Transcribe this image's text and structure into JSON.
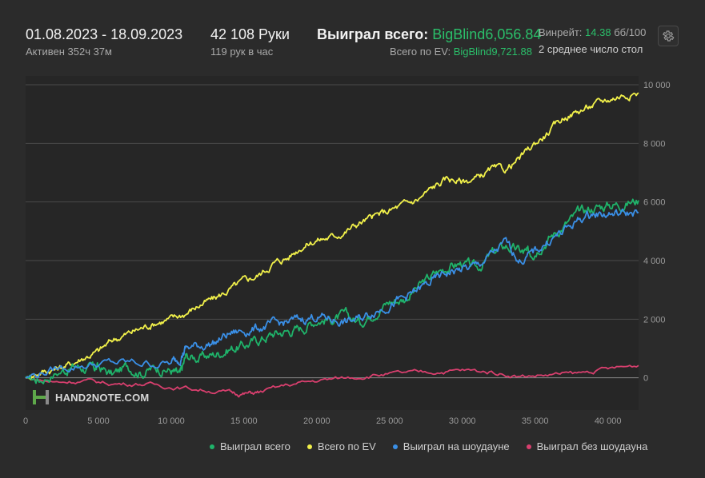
{
  "header": {
    "date_range": "01.08.2023 - 18.09.2023",
    "active_time": "Активен 352ч 37м",
    "hands": "42 108 Руки",
    "hands_per_hour": "119 рук в час",
    "won_label": "Выиграл всего:",
    "won_value": "BigBlind6,056.84",
    "ev_label": "Всего по EV:",
    "ev_value": "BigBlind9,721.88",
    "winrate_label": "Винрейт:",
    "winrate_value": "14.38",
    "winrate_unit": "бб/100",
    "avg_label": "2 среднее число стол"
  },
  "colors": {
    "green": "#1fb36a",
    "yellow": "#f1f04a",
    "blue": "#3a8fe6",
    "pink": "#d83f6e",
    "grid": "#4a4a4a",
    "axis_text": "#9a9a9a"
  },
  "logo": {
    "text": "HAND2NOTE.COM"
  },
  "chart_data": {
    "type": "line",
    "x_ticks": [
      0,
      5000,
      10000,
      15000,
      20000,
      25000,
      30000,
      35000,
      40000
    ],
    "x_tick_labels": [
      "0",
      "5 000",
      "10 000",
      "15 000",
      "20 000",
      "25 000",
      "30 000",
      "35 000",
      "40 000"
    ],
    "y_ticks": [
      0,
      2000,
      4000,
      6000,
      8000,
      10000
    ],
    "y_tick_labels": [
      "0",
      "2 000",
      "4 000",
      "6 000",
      "8 000",
      "10 000"
    ],
    "xlim": [
      0,
      42108
    ],
    "ylim": [
      -1100,
      10300
    ],
    "legend_position": "bottom-right",
    "series": [
      {
        "name": "Выиграл всего",
        "color": "#1fb36a",
        "points": [
          [
            0,
            0
          ],
          [
            1000,
            -50
          ],
          [
            2500,
            250
          ],
          [
            3500,
            400
          ],
          [
            4500,
            300
          ],
          [
            5000,
            350
          ],
          [
            6000,
            100
          ],
          [
            7000,
            400
          ],
          [
            8000,
            200
          ],
          [
            9000,
            350
          ],
          [
            10000,
            250
          ],
          [
            10600,
            50
          ],
          [
            11000,
            700
          ],
          [
            12000,
            700
          ],
          [
            13000,
            800
          ],
          [
            14000,
            1000
          ],
          [
            15000,
            1100
          ],
          [
            16000,
            1300
          ],
          [
            17000,
            1500
          ],
          [
            18000,
            1600
          ],
          [
            19000,
            1700
          ],
          [
            20000,
            2000
          ],
          [
            21000,
            2000
          ],
          [
            22000,
            2100
          ],
          [
            23000,
            1900
          ],
          [
            24000,
            2300
          ],
          [
            25000,
            2600
          ],
          [
            26000,
            2700
          ],
          [
            27000,
            3100
          ],
          [
            28000,
            3500
          ],
          [
            29000,
            3800
          ],
          [
            30000,
            3900
          ],
          [
            31000,
            3700
          ],
          [
            32000,
            4200
          ],
          [
            33000,
            4500
          ],
          [
            34000,
            4300
          ],
          [
            34500,
            4200
          ],
          [
            35000,
            4400
          ],
          [
            36000,
            4800
          ],
          [
            37000,
            5200
          ],
          [
            38000,
            5600
          ],
          [
            39000,
            5800
          ],
          [
            40000,
            5900
          ],
          [
            41000,
            5950
          ],
          [
            42108,
            6057
          ]
        ]
      },
      {
        "name": "Всего по EV",
        "color": "#f1f04a",
        "points": [
          [
            0,
            0
          ],
          [
            1000,
            200
          ],
          [
            2000,
            300
          ],
          [
            3000,
            450
          ],
          [
            4000,
            700
          ],
          [
            5000,
            900
          ],
          [
            6000,
            1300
          ],
          [
            7000,
            1500
          ],
          [
            8000,
            1700
          ],
          [
            9000,
            1900
          ],
          [
            10000,
            2000
          ],
          [
            11000,
            2200
          ],
          [
            12000,
            2500
          ],
          [
            13000,
            2700
          ],
          [
            14000,
            3000
          ],
          [
            15000,
            3300
          ],
          [
            16000,
            3500
          ],
          [
            17000,
            3900
          ],
          [
            18000,
            4100
          ],
          [
            19000,
            4500
          ],
          [
            20000,
            4700
          ],
          [
            21000,
            4800
          ],
          [
            22000,
            5000
          ],
          [
            23000,
            5300
          ],
          [
            24000,
            5500
          ],
          [
            25000,
            5700
          ],
          [
            26000,
            5900
          ],
          [
            27000,
            6100
          ],
          [
            28000,
            6500
          ],
          [
            29000,
            6800
          ],
          [
            30000,
            6700
          ],
          [
            31000,
            6800
          ],
          [
            32000,
            7100
          ],
          [
            33000,
            7100
          ],
          [
            34000,
            7500
          ],
          [
            35000,
            8000
          ],
          [
            36000,
            8400
          ],
          [
            37000,
            8900
          ],
          [
            38000,
            9100
          ],
          [
            39000,
            9300
          ],
          [
            40000,
            9500
          ],
          [
            41000,
            9650
          ],
          [
            42108,
            9722
          ]
        ]
      },
      {
        "name": "Выиграл на шоудауне",
        "color": "#3a8fe6",
        "points": [
          [
            0,
            0
          ],
          [
            2000,
            300
          ],
          [
            4000,
            450
          ],
          [
            6000,
            500
          ],
          [
            8000,
            500
          ],
          [
            10000,
            500
          ],
          [
            10600,
            700
          ],
          [
            11000,
            1000
          ],
          [
            12000,
            1100
          ],
          [
            13000,
            1200
          ],
          [
            14000,
            1500
          ],
          [
            15000,
            1600
          ],
          [
            16000,
            1700
          ],
          [
            17000,
            1800
          ],
          [
            18000,
            1900
          ],
          [
            19000,
            2000
          ],
          [
            20000,
            2100
          ],
          [
            21000,
            2000
          ],
          [
            22000,
            1900
          ],
          [
            23000,
            2000
          ],
          [
            24000,
            2300
          ],
          [
            25000,
            2500
          ],
          [
            26000,
            2700
          ],
          [
            27000,
            3000
          ],
          [
            28000,
            3300
          ],
          [
            29000,
            3600
          ],
          [
            30000,
            3700
          ],
          [
            31000,
            3800
          ],
          [
            32000,
            4200
          ],
          [
            33000,
            4600
          ],
          [
            34000,
            4000
          ],
          [
            35000,
            4300
          ],
          [
            36000,
            4700
          ],
          [
            37000,
            5000
          ],
          [
            38000,
            5400
          ],
          [
            39000,
            5600
          ],
          [
            40000,
            5600
          ],
          [
            41000,
            5600
          ],
          [
            42108,
            5650
          ]
        ]
      },
      {
        "name": "Выиграл без шоудауна",
        "color": "#d83f6e",
        "points": [
          [
            0,
            0
          ],
          [
            2000,
            -150
          ],
          [
            4000,
            -100
          ],
          [
            6000,
            -200
          ],
          [
            8000,
            -200
          ],
          [
            10000,
            -300
          ],
          [
            12000,
            -400
          ],
          [
            14000,
            -500
          ],
          [
            15000,
            -550
          ],
          [
            16000,
            -500
          ],
          [
            18000,
            -250
          ],
          [
            20000,
            -100
          ],
          [
            22000,
            0
          ],
          [
            24000,
            100
          ],
          [
            26000,
            150
          ],
          [
            28000,
            200
          ],
          [
            30000,
            250
          ],
          [
            32000,
            200
          ],
          [
            34000,
            50
          ],
          [
            36000,
            100
          ],
          [
            38000,
            150
          ],
          [
            40000,
            300
          ],
          [
            42108,
            420
          ]
        ]
      }
    ]
  }
}
